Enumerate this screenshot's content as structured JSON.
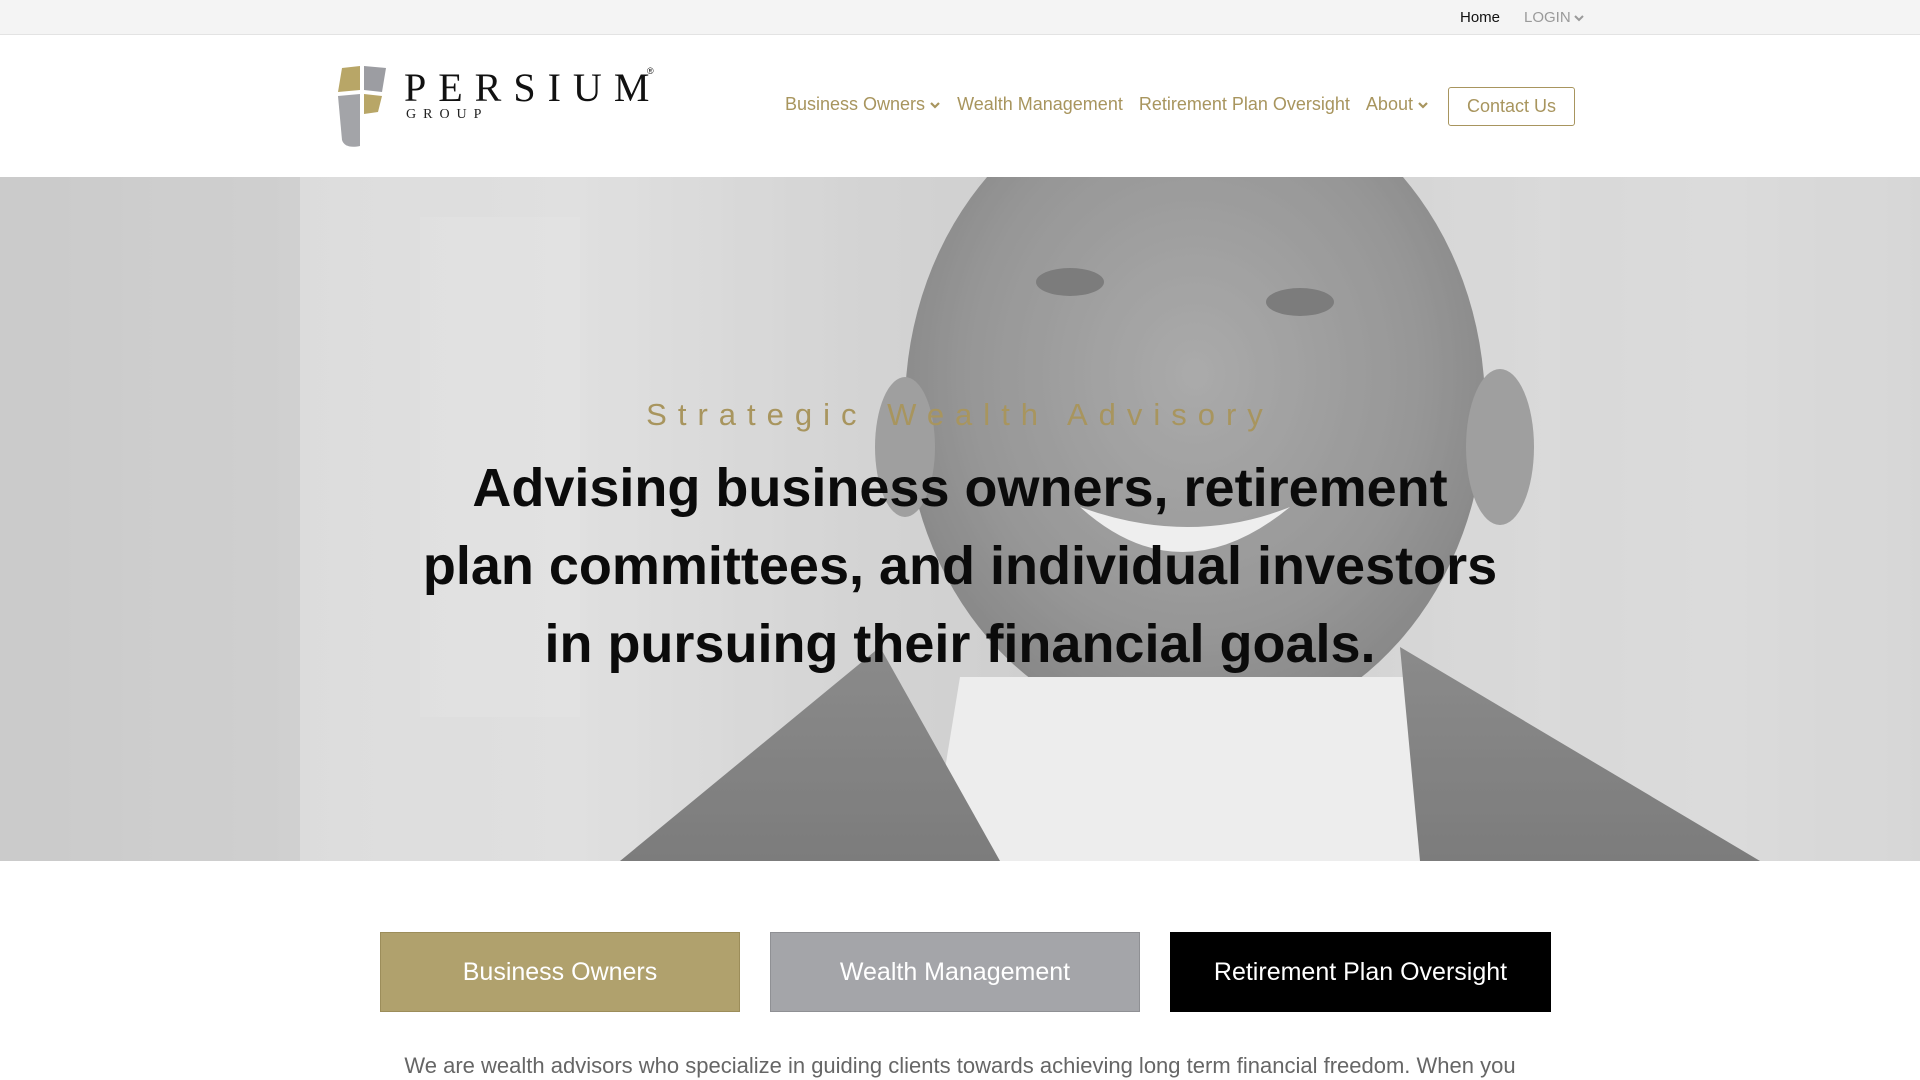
{
  "utility_bar": {
    "home": "Home",
    "login": "LOGIN"
  },
  "header": {
    "logo": {
      "word": "PERSIUM",
      "reg": "®",
      "sub": "GROUP"
    },
    "nav": [
      {
        "label": "Business Owners",
        "dropdown": true
      },
      {
        "label": "Wealth Management",
        "dropdown": false
      },
      {
        "label": "Retirement Plan Oversight",
        "dropdown": false
      },
      {
        "label": "About",
        "dropdown": true
      }
    ],
    "contact": "Contact Us"
  },
  "hero": {
    "kicker": "Strategic Wealth Advisory",
    "headline": "Advising business owners, retirement plan committees, and individual investors in pursuing their financial goals."
  },
  "cta": {
    "owners": "Business Owners",
    "wealth": "Wealth Management",
    "retirement": "Retirement Plan Oversight"
  },
  "intro": "We are wealth advisors who specialize in guiding clients towards achieving long term financial freedom. When you",
  "colors": {
    "gold": "#a8955e",
    "gold_button": "#b0a16d",
    "gray_button": "#a4a5a9",
    "black_button": "#000000"
  }
}
